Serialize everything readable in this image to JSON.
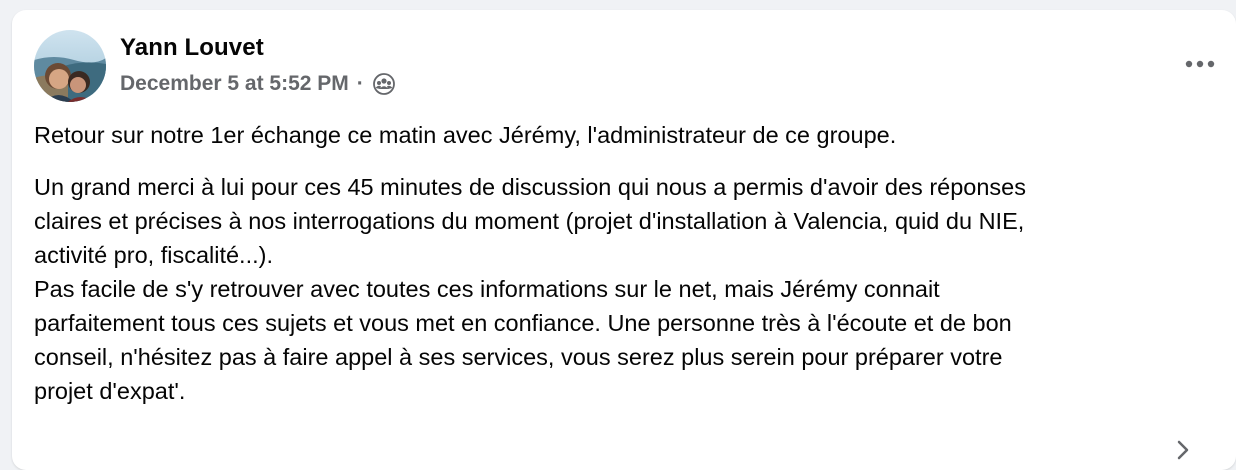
{
  "post": {
    "author": "Yann Louvet",
    "timestamp": "December 5 at 5:52 PM",
    "separator": "·",
    "audience_icon": "group-icon",
    "more_icon": "more-horizontal-icon",
    "paragraph1": "Retour sur notre 1er échange ce matin avec Jérémy, l'administrateur de ce groupe.",
    "paragraph2_lines": [
      "Un grand merci à lui pour ces 45 minutes de discussion qui nous a permis d'avoir des réponses",
      "claires et précises à nos interrogations du moment (projet d'installation à Valencia, quid du NIE,",
      "activité pro, fiscalité...).",
      "Pas facile de s'y retrouver avec toutes ces informations sur le net, mais Jérémy connait",
      "parfaitement tous ces sujets et vous met en confiance. Une personne très à l'écoute et de bon",
      "conseil, n'hésitez pas à faire appel à ses services, vous serez plus serein pour préparer votre",
      "projet d'expat'."
    ]
  },
  "colors": {
    "page_bg": "#f0f2f5",
    "card_bg": "#ffffff",
    "primary_text": "#050505",
    "secondary_text": "#65676b"
  }
}
